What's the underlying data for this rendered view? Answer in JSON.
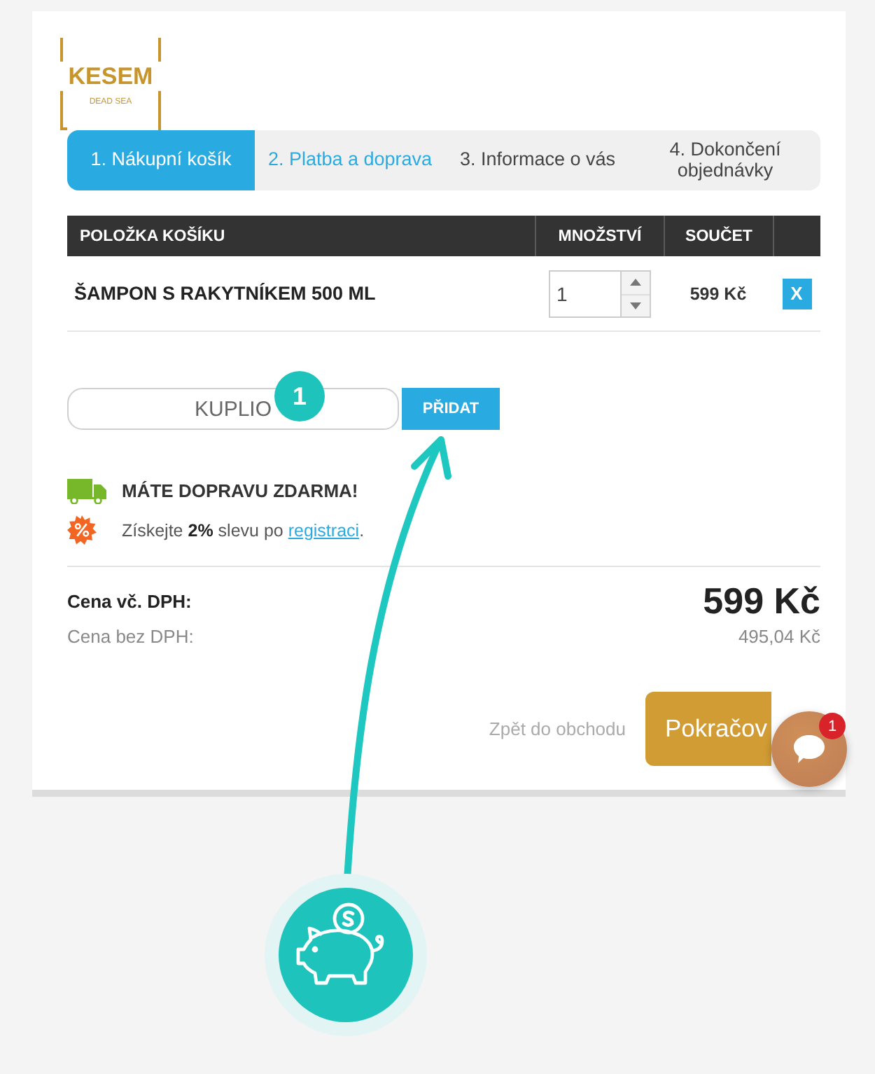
{
  "logo": {
    "wordmark": "KESEM",
    "tagline": "DEAD SEA"
  },
  "steps": [
    {
      "label": "1. Nákupní košík",
      "selected": true,
      "link": false
    },
    {
      "label": "2. Platba a doprava",
      "selected": false,
      "link": true
    },
    {
      "label": "3. Informace o vás",
      "selected": false,
      "link": false
    },
    {
      "label": "4. Dokončení objednávky",
      "selected": false,
      "link": false
    }
  ],
  "cart_table": {
    "columns": [
      "POLOŽKA KOŠÍKU",
      "MNOŽSTVÍ",
      "SOUČET"
    ],
    "rows": [
      {
        "product": "ŠAMPON S RAKYTNÍKEM 500 ML",
        "quantity": "1",
        "total": "599 Kč",
        "remove": "X"
      }
    ]
  },
  "coupon": {
    "value": "KUPLIO",
    "button": "PŘIDAT"
  },
  "notices": [
    {
      "kind": "shipping",
      "text": "MÁTE DOPRAVU ZDARMA!"
    },
    {
      "kind": "discount",
      "text": "Získejte **2%** slevu po",
      "link": "registraci",
      "text_after": "."
    }
  ],
  "totals": [
    {
      "kind": "gross",
      "label": "Cena vč. DPH:",
      "value": "599 Kč"
    },
    {
      "kind": "net",
      "label": "Cena bez DPH:",
      "value": "495,04 Kč"
    }
  ],
  "actions": {
    "back_link": "Zpět do obchodu",
    "continue_button": "Pokračov"
  },
  "annotation": {
    "step_badge": "1"
  },
  "chat": {
    "badge": "1"
  }
}
